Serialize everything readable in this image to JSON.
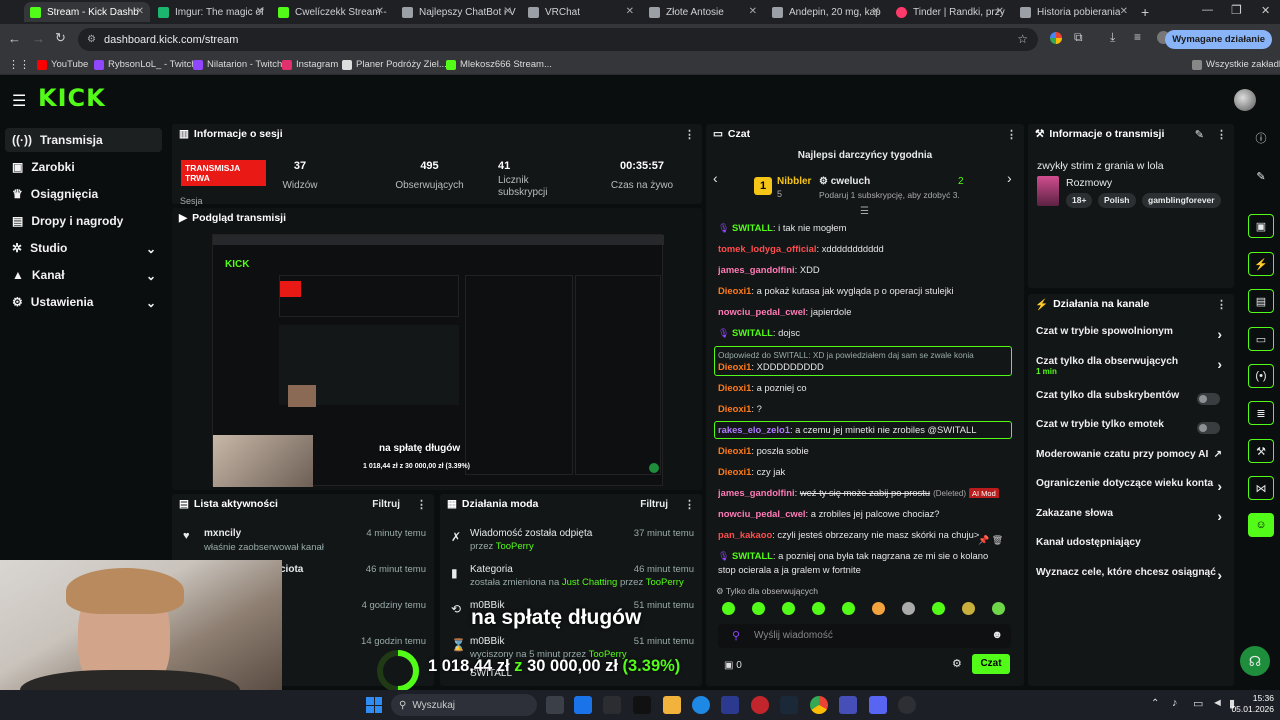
{
  "browser": {
    "tabs": [
      {
        "title": "Stream - Kick Dashb",
        "color": "#53fc18"
      },
      {
        "title": "Imgur: The magic of",
        "color": "#1bb76e"
      },
      {
        "title": "Cwelíczekk Stream - ",
        "color": "#53fc18"
      },
      {
        "title": "Najlepszy ChatBot i V",
        "color": "#9aa0a6"
      },
      {
        "title": "VRChat",
        "color": "#9aa0a6"
      },
      {
        "title": "Złote Antosie",
        "color": "#9aa0a6"
      },
      {
        "title": "Andepin, 20 mg, kap",
        "color": "#9aa0a6"
      },
      {
        "title": "Tinder | Randki, przy",
        "color": "#fd3a6a"
      },
      {
        "title": "Historia pobierania",
        "color": "#9aa0a6"
      }
    ],
    "url": "dashboard.kick.com/stream",
    "required_label": "Wymagane działanie",
    "bookmarks": [
      "YouTube",
      "RybsonLoL_ - Twitch",
      "Nilatarion - Twitch",
      "Instagram",
      "Planer Podróży Ziel...",
      "Mlekosz666 Stream..."
    ],
    "all_bookmarks": "Wszystkie zakładki"
  },
  "kick": {
    "logo": "KICK",
    "sidebar": [
      {
        "label": "Transmisja",
        "icon": "broadcast-icon"
      },
      {
        "label": "Zarobki",
        "icon": "wallet-icon"
      },
      {
        "label": "Osiągnięcia",
        "icon": "trophy-icon"
      },
      {
        "label": "Dropy i nagrody",
        "icon": "gift-icon"
      },
      {
        "label": "Studio",
        "icon": "studio-icon"
      },
      {
        "label": "Kanał",
        "icon": "channel-icon"
      },
      {
        "label": "Ustawienia",
        "icon": "gear-icon"
      }
    ],
    "session": {
      "title": "Informacje o sesji",
      "live_badge": "TRANSMISJA TRWA",
      "session_label": "Sesja",
      "stats": [
        {
          "value": "37",
          "label": "Widzów"
        },
        {
          "value": "495",
          "label": "Obserwujących"
        },
        {
          "value": "41",
          "label": "Licznik subskrypcji"
        },
        {
          "value": "00:35:57",
          "label": "Czas na żywo"
        }
      ]
    },
    "preview": {
      "title": "Podgląd transmisji",
      "overlay_text": "na spłatę długów",
      "overlay_amount": "1 018,44 zł z 30 000,00 zł (3.39%)"
    },
    "activity": {
      "title": "Lista aktywności",
      "filter": "Filtruj",
      "items": [
        {
          "user": "mxncily",
          "action": "właśnie zaobserwował kanał",
          "time": "4 minuty temu"
        },
        {
          "user": "ciota",
          "action": "",
          "time": "46 minut temu"
        },
        {
          "user": "",
          "action": "",
          "time": "4 godziny temu"
        },
        {
          "user": "",
          "action": "",
          "time": "14 godzin temu"
        }
      ]
    },
    "modlog": {
      "title": "Działania moda",
      "filter": "Filtruj",
      "items": [
        {
          "title": "Wiadomość została odpięta",
          "line": "przez",
          "mod": "TooPerry",
          "time": "37 minut temu"
        },
        {
          "title": "Kategoria",
          "line": "została zmieniona na",
          "category": "Just Chatting",
          "by": "przez",
          "mod": "TooPerry",
          "time": "46 minut temu"
        },
        {
          "title": "m0BBik",
          "line": "",
          "mod": "",
          "time": "51 minut temu"
        },
        {
          "title": "m0BBik",
          "line": "wyciszony na 5 minut przez",
          "mod": "TooPerry",
          "time": "51 minut temu"
        },
        {
          "title": "SWITALL",
          "line": "",
          "mod": "",
          "time": ""
        }
      ]
    },
    "chat": {
      "title": "Czat",
      "top_title": "Najlepsi darczyńcy tygodnia",
      "top1_name": "Nibbler",
      "top1_rank": "1",
      "top1_count": "5",
      "top2_name": "cweluch",
      "top2_count": "2",
      "top2_hint": "Podaruj 1 subskrypcję, aby zdobyć 3.",
      "messages": [
        {
          "user": "SWITALL",
          "color": "#53fc18",
          "text": "i tak nie mogłem"
        },
        {
          "user": "tomek_lodyga_official",
          "color": "#ff4d4d",
          "text": "xddddddddddd"
        },
        {
          "user": "james_gandolfini",
          "color": "#ff7ab6",
          "text": "XDD"
        },
        {
          "user": "Dieoxi1",
          "color": "#ff7a1a",
          "text": "a pokaż kutasa jak wygląda p o operacji stulejki"
        },
        {
          "user": "nowciu_pedal_cwel",
          "color": "#ff7ab6",
          "text": "japierdole"
        },
        {
          "user": "SWITALL",
          "color": "#53fc18",
          "text": "dojsc"
        },
        {
          "user": "Dieoxi1",
          "color": "#ff7a1a",
          "text": "XDDDDDDDDD",
          "reply": "Odpowiedź do SWITALL: XD ja powiedziałem daj sam se zwale konia"
        },
        {
          "user": "Dieoxi1",
          "color": "#ff7a1a",
          "text": "a pozniej co"
        },
        {
          "user": "Dieoxi1",
          "color": "#ff7a1a",
          "text": "?"
        },
        {
          "user": "rakes_elo_zelo1",
          "color": "#b07cff",
          "text": "a czemu jej minetki nie zrobiles @SWITALL"
        },
        {
          "user": "Dieoxi1",
          "color": "#ff7a1a",
          "text": "poszła sobie"
        },
        {
          "user": "Dieoxi1",
          "color": "#ff7a1a",
          "text": "czy jak"
        },
        {
          "user": "james_gandolfini",
          "color": "#ff7ab6",
          "text": "weź ty się może zabij po prostu",
          "deleted": "(Deleted)",
          "ai": "AI Mod"
        },
        {
          "user": "nowciu_pedal_cwel",
          "color": "#ff7ab6",
          "text": "a zrobiles jej palcowe chociaz?"
        },
        {
          "user": "pan_kakaoo",
          "color": "#ff4d4d",
          "text": "czyli jesteś obrzezany nie masz skórki na chuju>"
        },
        {
          "user": "SWITALL",
          "color": "#53fc18",
          "text": "a pozniej ona była tak nagrzana ze mi sie o kolano",
          "cont": "stop ocierala a ja gralem w fortnite"
        }
      ],
      "mode": "Tylko dla obserwujących",
      "placeholder": "Wyślij wiadomość",
      "send": "Czat"
    },
    "info": {
      "title": "Informacje o transmisji",
      "stream_title": "zwykły strim z grania w lola",
      "category": "Rozmowy",
      "tags": [
        "18+",
        "Polish",
        "gamblingforever"
      ]
    },
    "channel": {
      "title": "Działania na kanale",
      "items": [
        {
          "label": "Czat w trybie spowolnionym",
          "sub": "",
          "kind": "chevron"
        },
        {
          "label": "Czat tylko dla obserwujących",
          "sub": "1 min",
          "kind": "chevron"
        },
        {
          "label": "Czat tylko dla subskrybentów",
          "sub": "",
          "kind": "toggle"
        },
        {
          "label": "Czat w trybie tylko emotek",
          "sub": "",
          "kind": "toggle"
        },
        {
          "label": "Moderowanie czatu przy pomocy AI",
          "sub": "",
          "kind": "external"
        },
        {
          "label": "Ograniczenie dotyczące wieku konta",
          "sub": "",
          "kind": "chevron"
        },
        {
          "label": "Zakazane słowa",
          "sub": "",
          "kind": "chevron"
        },
        {
          "label": "Kanał udostępniający",
          "sub": "",
          "kind": "none"
        },
        {
          "label": "Wyznacz cele, które chcesz osiągnąć",
          "sub": "",
          "kind": "chevron"
        }
      ]
    }
  },
  "overlay": {
    "goal_text": "na spłatę długów",
    "amount_current": "1 018,44 zł",
    "amount_sep": "z",
    "amount_target": "30 000,00 zł",
    "amount_pct": "(3.39%)",
    "counter": "0",
    "progress": 0.0339
  },
  "taskbar": {
    "search": "Wyszukaj",
    "time": "15:36",
    "date": "05.01.2026"
  },
  "colors": {
    "accent": "#53fc18",
    "live": "#e91916"
  }
}
